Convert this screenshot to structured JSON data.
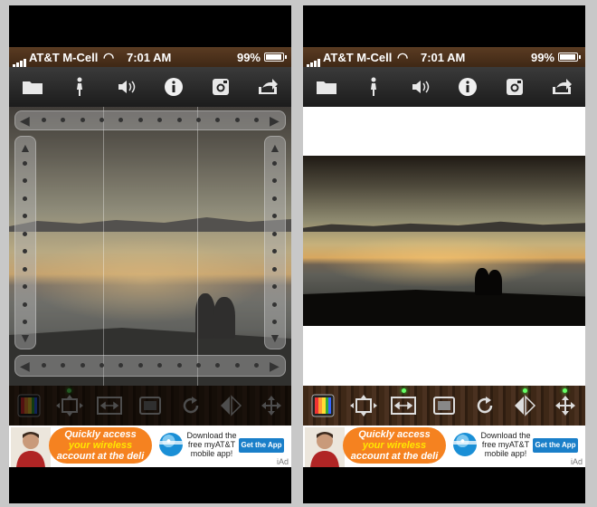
{
  "status": {
    "carrier": "AT&T M-Cell",
    "time": "7:01 AM",
    "battery": "99%"
  },
  "toolbar": {
    "icons": [
      "folder-icon",
      "person-walk-icon",
      "speaker-icon",
      "info-icon",
      "instagram-icon",
      "share-icon"
    ]
  },
  "bottombar": {
    "buttons": [
      "color-filter-icon",
      "crop-expand-icon",
      "aspect-fit-icon",
      "frame-icon",
      "rotate-icon",
      "flip-icon",
      "move-icon"
    ]
  },
  "ad": {
    "headline_top": "Quickly access",
    "headline_highlight": "your wireless",
    "headline_bottom": "account at the deli",
    "promo_line1": "Download the",
    "promo_line2": "free myAT&T",
    "promo_line3": "mobile app!",
    "cta": "Get the App",
    "network": "iAd"
  },
  "colors": {
    "ad_orange": "#f58220",
    "cta_blue": "#1a7fc9",
    "led_green": "#66ff66",
    "bar_wood": "#4a3120"
  }
}
